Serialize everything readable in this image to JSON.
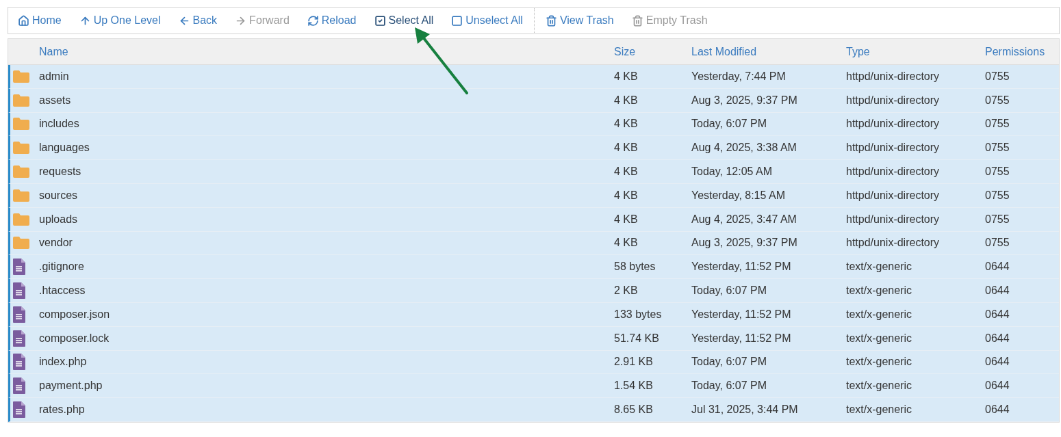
{
  "toolbar": [
    {
      "label": "Home",
      "disabled": false
    },
    {
      "label": "Up One Level",
      "disabled": false
    },
    {
      "label": "Back",
      "disabled": false
    },
    {
      "label": "Forward",
      "disabled": true
    },
    {
      "label": "Reload",
      "disabled": false
    },
    {
      "label": "Select All",
      "disabled": false,
      "emphasized": true
    },
    {
      "label": "Unselect All",
      "disabled": false
    },
    {
      "label": "View Trash",
      "disabled": false,
      "separator_before": true
    },
    {
      "label": "Empty Trash",
      "disabled": true
    }
  ],
  "table": {
    "columns": [
      "Name",
      "Size",
      "Last Modified",
      "Type",
      "Permissions"
    ],
    "rows": [
      {
        "kind": "folder",
        "selected": true,
        "cells": [
          "admin",
          "4 KB",
          "Yesterday, 7:44 PM",
          "httpd/unix-directory",
          "0755"
        ]
      },
      {
        "kind": "folder",
        "selected": true,
        "cells": [
          "assets",
          "4 KB",
          "Aug 3, 2025, 9:37 PM",
          "httpd/unix-directory",
          "0755"
        ]
      },
      {
        "kind": "folder",
        "selected": true,
        "cells": [
          "includes",
          "4 KB",
          "Today, 6:07 PM",
          "httpd/unix-directory",
          "0755"
        ]
      },
      {
        "kind": "folder",
        "selected": true,
        "cells": [
          "languages",
          "4 KB",
          "Aug 4, 2025, 3:38 AM",
          "httpd/unix-directory",
          "0755"
        ]
      },
      {
        "kind": "folder",
        "selected": true,
        "cells": [
          "requests",
          "4 KB",
          "Today, 12:05 AM",
          "httpd/unix-directory",
          "0755"
        ]
      },
      {
        "kind": "folder",
        "selected": true,
        "cells": [
          "sources",
          "4 KB",
          "Yesterday, 8:15 AM",
          "httpd/unix-directory",
          "0755"
        ]
      },
      {
        "kind": "folder",
        "selected": true,
        "cells": [
          "uploads",
          "4 KB",
          "Aug 4, 2025, 3:47 AM",
          "httpd/unix-directory",
          "0755"
        ]
      },
      {
        "kind": "folder",
        "selected": true,
        "cells": [
          "vendor",
          "4 KB",
          "Aug 3, 2025, 9:37 PM",
          "httpd/unix-directory",
          "0755"
        ]
      },
      {
        "kind": "file",
        "selected": true,
        "cells": [
          ".gitignore",
          "58 bytes",
          "Yesterday, 11:52 PM",
          "text/x-generic",
          "0644"
        ]
      },
      {
        "kind": "file",
        "selected": true,
        "cells": [
          ".htaccess",
          "2 KB",
          "Today, 6:07 PM",
          "text/x-generic",
          "0644"
        ]
      },
      {
        "kind": "file",
        "selected": true,
        "cells": [
          "composer.json",
          "133 bytes",
          "Yesterday, 11:52 PM",
          "text/x-generic",
          "0644"
        ]
      },
      {
        "kind": "file",
        "selected": true,
        "cells": [
          "composer.lock",
          "51.74 KB",
          "Yesterday, 11:52 PM",
          "text/x-generic",
          "0644"
        ]
      },
      {
        "kind": "file",
        "selected": true,
        "cells": [
          "index.php",
          "2.91 KB",
          "Today, 6:07 PM",
          "text/x-generic",
          "0644"
        ]
      },
      {
        "kind": "file",
        "selected": true,
        "cells": [
          "payment.php",
          "1.54 KB",
          "Today, 6:07 PM",
          "text/x-generic",
          "0644"
        ]
      },
      {
        "kind": "file",
        "selected": true,
        "cells": [
          "rates.php",
          "8.65 KB",
          "Jul 31, 2025, 3:44 PM",
          "text/x-generic",
          "0644"
        ]
      }
    ]
  }
}
